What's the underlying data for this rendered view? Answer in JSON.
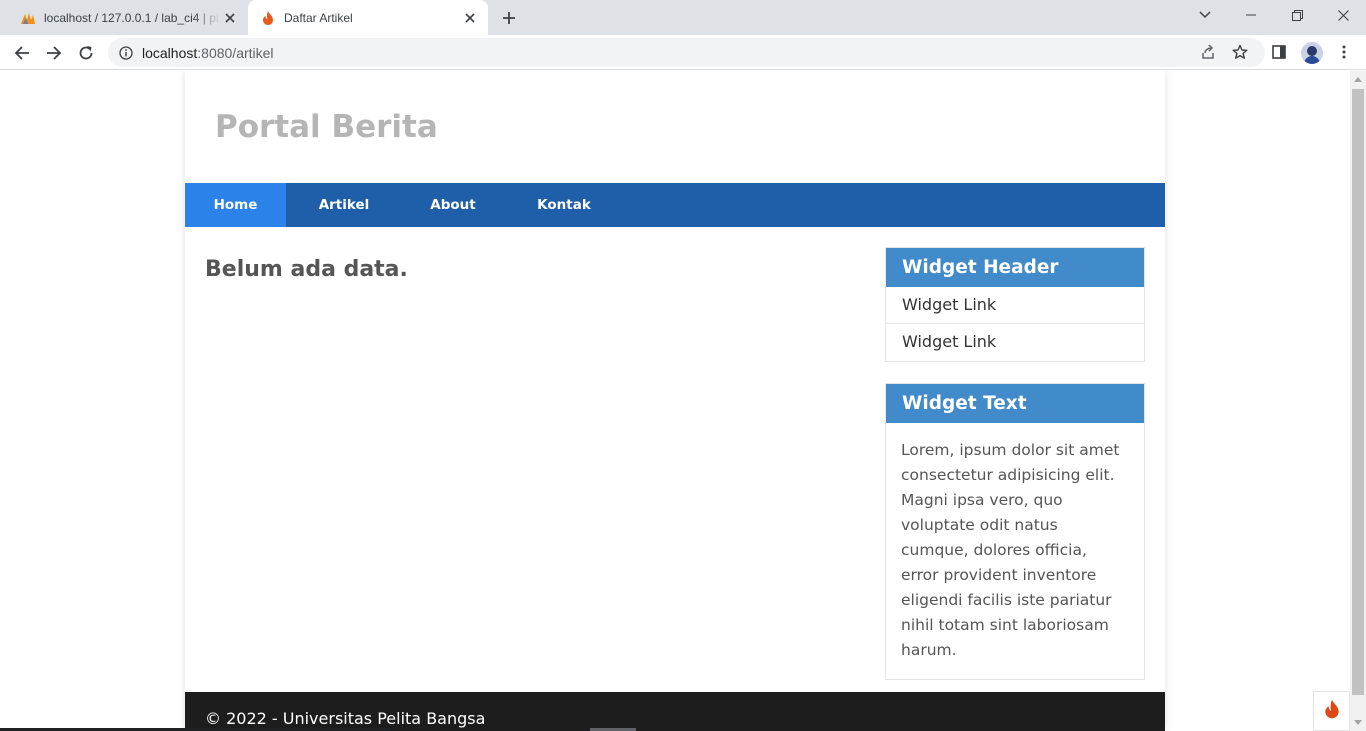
{
  "browser": {
    "tabs": [
      {
        "title": "localhost / 127.0.0.1 / lab_ci4 | phpMyAdmin",
        "icon": "phpmyadmin-icon",
        "active": false
      },
      {
        "title": "Daftar Artikel",
        "icon": "codeigniter-flame-icon",
        "active": true
      }
    ],
    "url_host": "localhost",
    "url_rest": ":8080/artikel"
  },
  "site": {
    "title": "Portal Berita",
    "nav": [
      {
        "label": "Home",
        "active": true
      },
      {
        "label": "Artikel",
        "active": false
      },
      {
        "label": "About",
        "active": false
      },
      {
        "label": "Kontak",
        "active": false
      }
    ],
    "empty_message": "Belum ada data.",
    "sidebar": {
      "widget_header": {
        "title": "Widget Header",
        "links": [
          "Widget Link",
          "Widget Link"
        ]
      },
      "widget_text": {
        "title": "Widget Text",
        "body": "Lorem, ipsum dolor sit amet consectetur adipisicing elit. Magni ipsa vero, quo voluptate odit natus cumque, dolores officia, error provident inventore eligendi facilis iste pariatur nihil totam sint laboriosam harum."
      }
    },
    "footer": "© 2022 - Universitas Pelita Bangsa"
  },
  "colors": {
    "nav_bg": "#1f5faa",
    "nav_active": "#2b83ea",
    "widget_header_bg": "#428bca",
    "footer_bg": "#1d1d1d",
    "title": "#b5b5b5"
  }
}
